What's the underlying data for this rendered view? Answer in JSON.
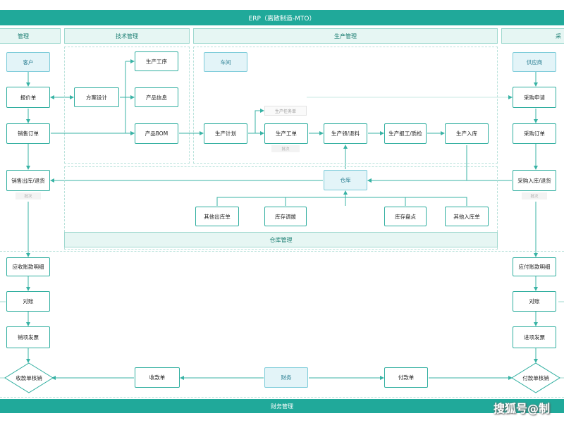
{
  "title": "ERP（离散制造-MTO）",
  "sections": {
    "sales": "管理",
    "tech": "技术管理",
    "production": "生产管理",
    "purchase": "采",
    "warehouse": "仓库管理",
    "finance": "财务管理"
  },
  "roles": {
    "customer": "客户",
    "workshop": "车间",
    "supplier": "供应商",
    "warehouse": "仓库",
    "finance": "财务"
  },
  "nodes": {
    "quote": "报价单",
    "sales_order": "销售订单",
    "sales_out": "销售出库/退货",
    "receivable_detail": "应收账款明细",
    "reconcile_left": "对账",
    "sales_invoice": "销项发票",
    "receipt_writeoff": "收款单核销",
    "receipt": "收款单",
    "payment": "付款单",
    "payment_writeoff": "付款单核销",
    "purchase_invoice": "进项发票",
    "reconcile_right": "对账",
    "payable_detail": "应付账款明细",
    "purchase_in": "采购入库/退货",
    "purchase_order": "采购订单",
    "purchase_request": "采购申请",
    "solution_design": "方案设计",
    "process": "生产工序",
    "product_info": "产品信息",
    "product_bom": "产品BOM",
    "production_plan": "生产计划",
    "work_order": "生产工单",
    "material": "生产领/退料",
    "report_qc": "生产报工/质检",
    "prod_in": "生产入库",
    "other_out": "其他出库单",
    "transfer": "库存调拨",
    "stocktake": "库存盘点",
    "other_in": "其他入库单"
  },
  "ghost": {
    "task_list": "生产任务单",
    "batch_work": "批次",
    "batch_sales": "批次",
    "batch_purchase": "批次"
  },
  "watermark": "搜狐号@制",
  "colors": {
    "banner": "#20a99a",
    "section_bg": "#e6f6f3",
    "node_border": "#2fae9f",
    "role_bg": "#e3f4f8",
    "line": "#39b3a5"
  }
}
